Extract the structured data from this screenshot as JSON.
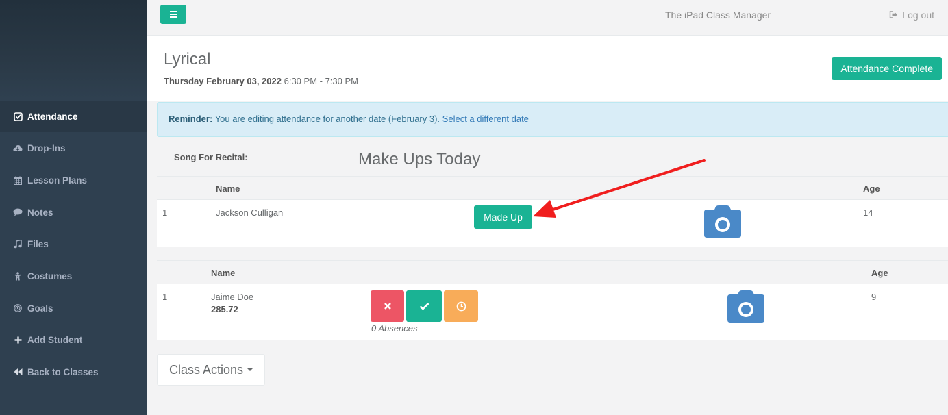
{
  "app": {
    "title": "The iPad Class Manager",
    "logout_label": "Log out"
  },
  "sidebar": {
    "items": [
      {
        "label": "Attendance",
        "icon": "check-square-icon",
        "active": true
      },
      {
        "label": "Drop-Ins",
        "icon": "cloud-download-icon"
      },
      {
        "label": "Lesson Plans",
        "icon": "calendar-icon"
      },
      {
        "label": "Notes",
        "icon": "comment-icon"
      },
      {
        "label": "Files",
        "icon": "music-icon"
      },
      {
        "label": "Costumes",
        "icon": "child-icon"
      },
      {
        "label": "Goals",
        "icon": "bullseye-icon"
      },
      {
        "label": "Add Student",
        "icon": "plus-icon"
      },
      {
        "label": "Back to Classes",
        "icon": "backward-icon"
      }
    ]
  },
  "class": {
    "name": "Lyrical",
    "date": "Thursday February 03, 2022",
    "time": "6:30 PM - 7:30 PM",
    "complete_label": "Attendance Complete"
  },
  "reminder": {
    "label": "Reminder:",
    "text": "You are editing attendance for another date (February 3).",
    "link": "Select a different date"
  },
  "song": {
    "label": "Song For Recital:"
  },
  "makeups": {
    "title": "Make Ups Today",
    "headers": {
      "name": "Name",
      "age": "Age"
    },
    "rows": [
      {
        "num": "1",
        "name": "Jackson Culligan",
        "button": "Made Up",
        "age": "14"
      }
    ]
  },
  "roster": {
    "headers": {
      "name": "Name",
      "age": "Age"
    },
    "rows": [
      {
        "num": "1",
        "name": "Jaime Doe",
        "balance": "285.72",
        "absences": "0 Absences",
        "age": "9"
      }
    ]
  },
  "actions": {
    "label": "Class Actions"
  },
  "colors": {
    "primary": "#1ab394",
    "danger": "#ed5565",
    "warning": "#f8ac59",
    "camera": "#4a89c8",
    "sidebar": "#2f4050",
    "arrow": "#f01e1e"
  }
}
